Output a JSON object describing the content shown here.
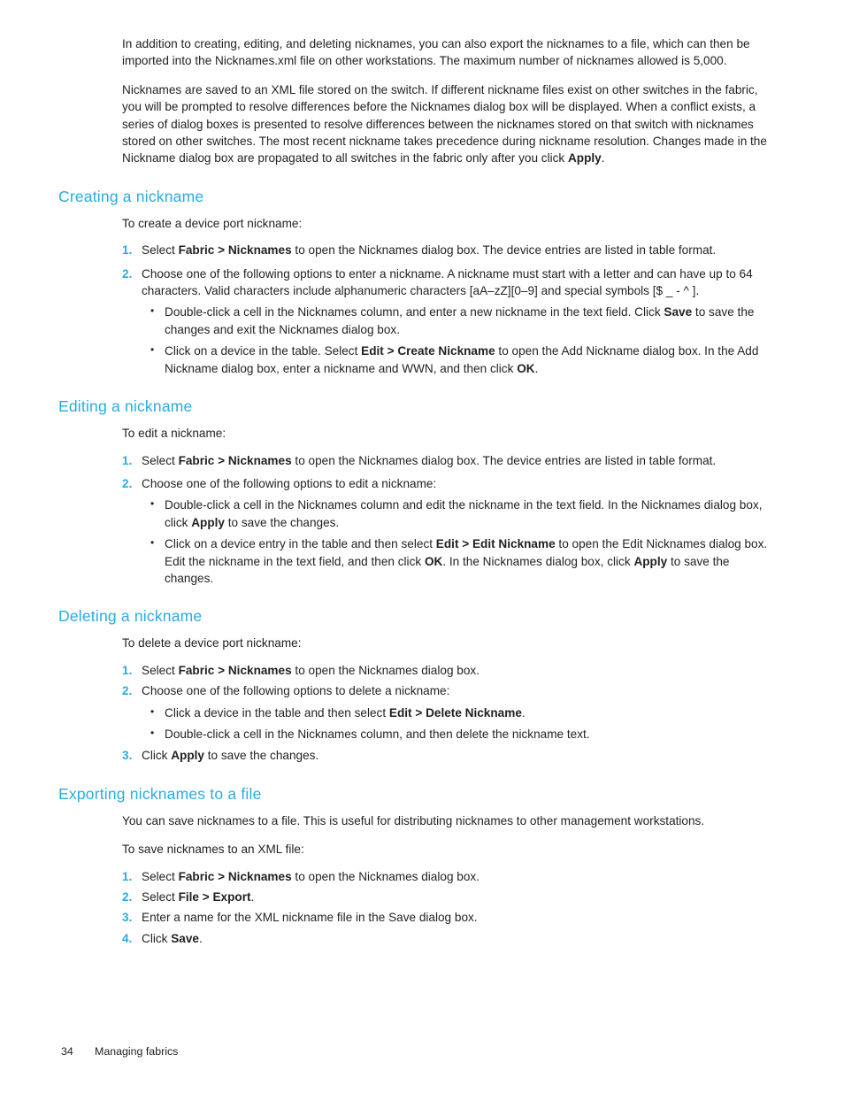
{
  "document": {
    "colors": {
      "heading": "#29abe2",
      "list_marker": "#29abe2",
      "body_text": "#231f20",
      "background": "#ffffff"
    }
  },
  "intro": {
    "paragraph_1": "In addition to creating, editing, and deleting nicknames, you can also export the nicknames to a file, which can then be imported into the Nicknames.xml file on other workstations. The maximum number of nicknames allowed is 5,000.",
    "paragraph_2_part1": "Nicknames are saved to an XML file stored on the switch. If different nickname files exist on other switches in the fabric, you will be prompted to resolve differences before the Nicknames dialog box will be displayed. When a conflict exists, a series of dialog boxes is presented to resolve differences between the nicknames stored on that switch with nicknames stored on other switches. The most recent nickname takes precedence during nickname resolution. Changes made in the Nickname dialog box are propagated to all switches in the fabric only after you click ",
    "paragraph_2_bold": "Apply",
    "paragraph_2_part2": "."
  },
  "creating": {
    "heading": "Creating a nickname",
    "intro": "To create a device port nickname:",
    "step1_part1": "Select ",
    "step1_bold": "Fabric > Nicknames",
    "step1_part2": " to open the Nicknames dialog box. The device entries are listed in table format.",
    "step2": "Choose one of the following options to enter a nickname. A nickname must start with a letter and can have up to 64 characters. Valid characters include alphanumeric characters [aA–zZ][0–9] and special symbols [$ _ - ^ ].",
    "bullet1_part1": "Double-click a cell in the Nicknames column, and enter a new nickname in the text field. Click ",
    "bullet1_bold": "Save",
    "bullet1_part2": " to save the changes and exit the Nicknames dialog box.",
    "bullet2_part1": "Click on a device in the table. Select ",
    "bullet2_bold1": "Edit > Create Nickname",
    "bullet2_part2": " to open the Add Nickname dialog box. In the Add Nickname dialog box, enter a nickname and WWN, and then click ",
    "bullet2_bold2": "OK",
    "bullet2_part3": "."
  },
  "editing": {
    "heading": "Editing a nickname",
    "intro": "To edit a nickname:",
    "step1_part1": "Select ",
    "step1_bold": "Fabric > Nicknames",
    "step1_part2": " to open the Nicknames dialog box. The device entries are listed in table format.",
    "step2": "Choose one of the following options to edit a nickname:",
    "bullet1_part1": "Double-click a cell in the Nicknames column and edit the nickname in the text field. In the Nicknames dialog box, click ",
    "bullet1_bold": "Apply",
    "bullet1_part2": " to save the changes.",
    "bullet2_part1": "Click on a device entry in the table and then select ",
    "bullet2_bold1": "Edit > Edit Nickname",
    "bullet2_part2": " to open the Edit Nicknames dialog box. Edit the nickname in the text field, and then click ",
    "bullet2_bold2": "OK",
    "bullet2_part3": ". In the Nicknames dialog box, click ",
    "bullet2_bold3": "Apply",
    "bullet2_part4": " to save the changes."
  },
  "deleting": {
    "heading": "Deleting a nickname",
    "intro": "To delete a device port nickname:",
    "step1_part1": "Select ",
    "step1_bold": "Fabric > Nicknames",
    "step1_part2": " to open the Nicknames dialog box.",
    "step2": "Choose one of the following options to delete a nickname:",
    "bullet1_part1": "Click a device in the table and then select ",
    "bullet1_bold": "Edit > Delete Nickname",
    "bullet1_part2": ".",
    "bullet2": "Double-click a cell in the Nicknames column, and then delete the nickname text.",
    "step3_part1": "Click ",
    "step3_bold": "Apply",
    "step3_part2": " to save the changes."
  },
  "exporting": {
    "heading": "Exporting nicknames to a file",
    "intro_para": "You can save nicknames to a file. This is useful for distributing nicknames to other management workstations.",
    "intro_list": "To save nicknames to an XML file:",
    "step1_part1": "Select ",
    "step1_bold": "Fabric > Nicknames",
    "step1_part2": " to open the Nicknames dialog box.",
    "step2_part1": "Select ",
    "step2_bold": "File > Export",
    "step2_part2": ".",
    "step3": "Enter a name for the XML nickname file in the Save dialog box.",
    "step4_part1": "Click ",
    "step4_bold": "Save",
    "step4_part2": "."
  },
  "footer": {
    "page_number": "34",
    "chapter": "Managing fabrics"
  }
}
